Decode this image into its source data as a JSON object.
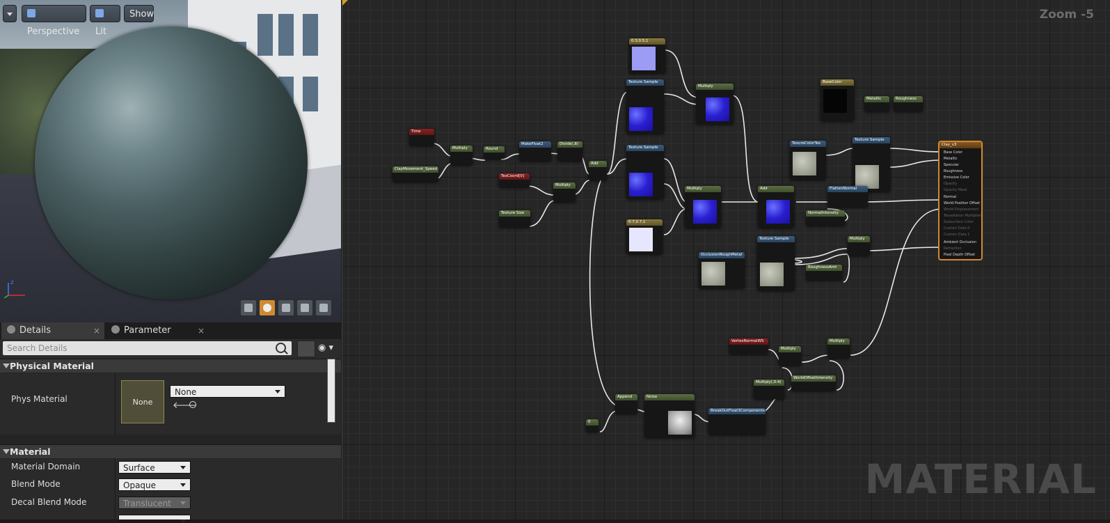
{
  "viewport": {
    "perspective_label": "Perspective",
    "lit_label": "Lit",
    "show_label": "Show"
  },
  "details_panel": {
    "tabs": [
      {
        "label": "Details"
      },
      {
        "label": "Parameter Defaults"
      }
    ],
    "search_placeholder": "Search Details",
    "sections": {
      "physical_material": "Physical Material",
      "material": "Material"
    },
    "phys_material": {
      "label": "Phys Material",
      "thumb_text": "None",
      "value": "None"
    },
    "material_props": [
      {
        "label": "Material Domain",
        "value": "Surface"
      },
      {
        "label": "Blend Mode",
        "value": "Opaque"
      },
      {
        "label": "Decal Blend Mode",
        "value": "Translucent"
      }
    ]
  },
  "graph": {
    "zoom_label": "Zoom -5",
    "watermark": "MATERIAL",
    "nodes": {
      "time": "Time",
      "clay_speed": "ClayMovement_Speed",
      "multiply1": "Multiply",
      "round": "Round",
      "make_float2": "MakeFloat2",
      "divide": "Divide(,8)",
      "add1": "Add",
      "texcoord": "TexCoord[0]",
      "multiply2": "Multiply",
      "texture_size": "Texture Size",
      "v3_top": "0.3,0.5,1",
      "tex_sample_top": "Texture Sample",
      "multiply_top": "Multiply",
      "tex_sample_mid": "Texture Sample",
      "multiply_mid": "Multiply",
      "v3_low": "0.7,0.7,1",
      "add2": "Add",
      "base_color": "BaseColor",
      "metallic": "Metallic",
      "roughness": "Roughness",
      "tex_base_color": "TexureColorTex",
      "tex_sample_right": "Texture Sample",
      "flatten_normal": "FlattenNormal",
      "normal_intensity": "NormalIntensity",
      "occlusion": "OcclusionRoughMetal",
      "tex_sample_bottom": "Texture Sample",
      "roughness_amt": "RoughnessAmt",
      "multiply_right": "Multiply",
      "vertex_normal": "VertexNormalWS",
      "multiply_low1": "Multiply",
      "multiply_low2": "Multiply",
      "multiply_low3": "Multiply(,0.4)",
      "world_offset": "WorldOffsetIntensity",
      "append": "Append",
      "noise": "Noise",
      "break_out": "BreakOutFloat3Components",
      "const": "0"
    },
    "result_node": {
      "title": "Clay_v3",
      "pins": [
        "Base Color",
        "Metallic",
        "Specular",
        "Roughness",
        "Emissive Color",
        "Opacity",
        "Opacity Mask",
        "Normal",
        "World Position Offset",
        "World Displacement",
        "Tessellation Multiplier",
        "Subsurface Color",
        "Custom Data 0",
        "Custom Data 1",
        "Ambient Occlusion",
        "Refraction",
        "Pixel Depth Offset"
      ]
    }
  }
}
